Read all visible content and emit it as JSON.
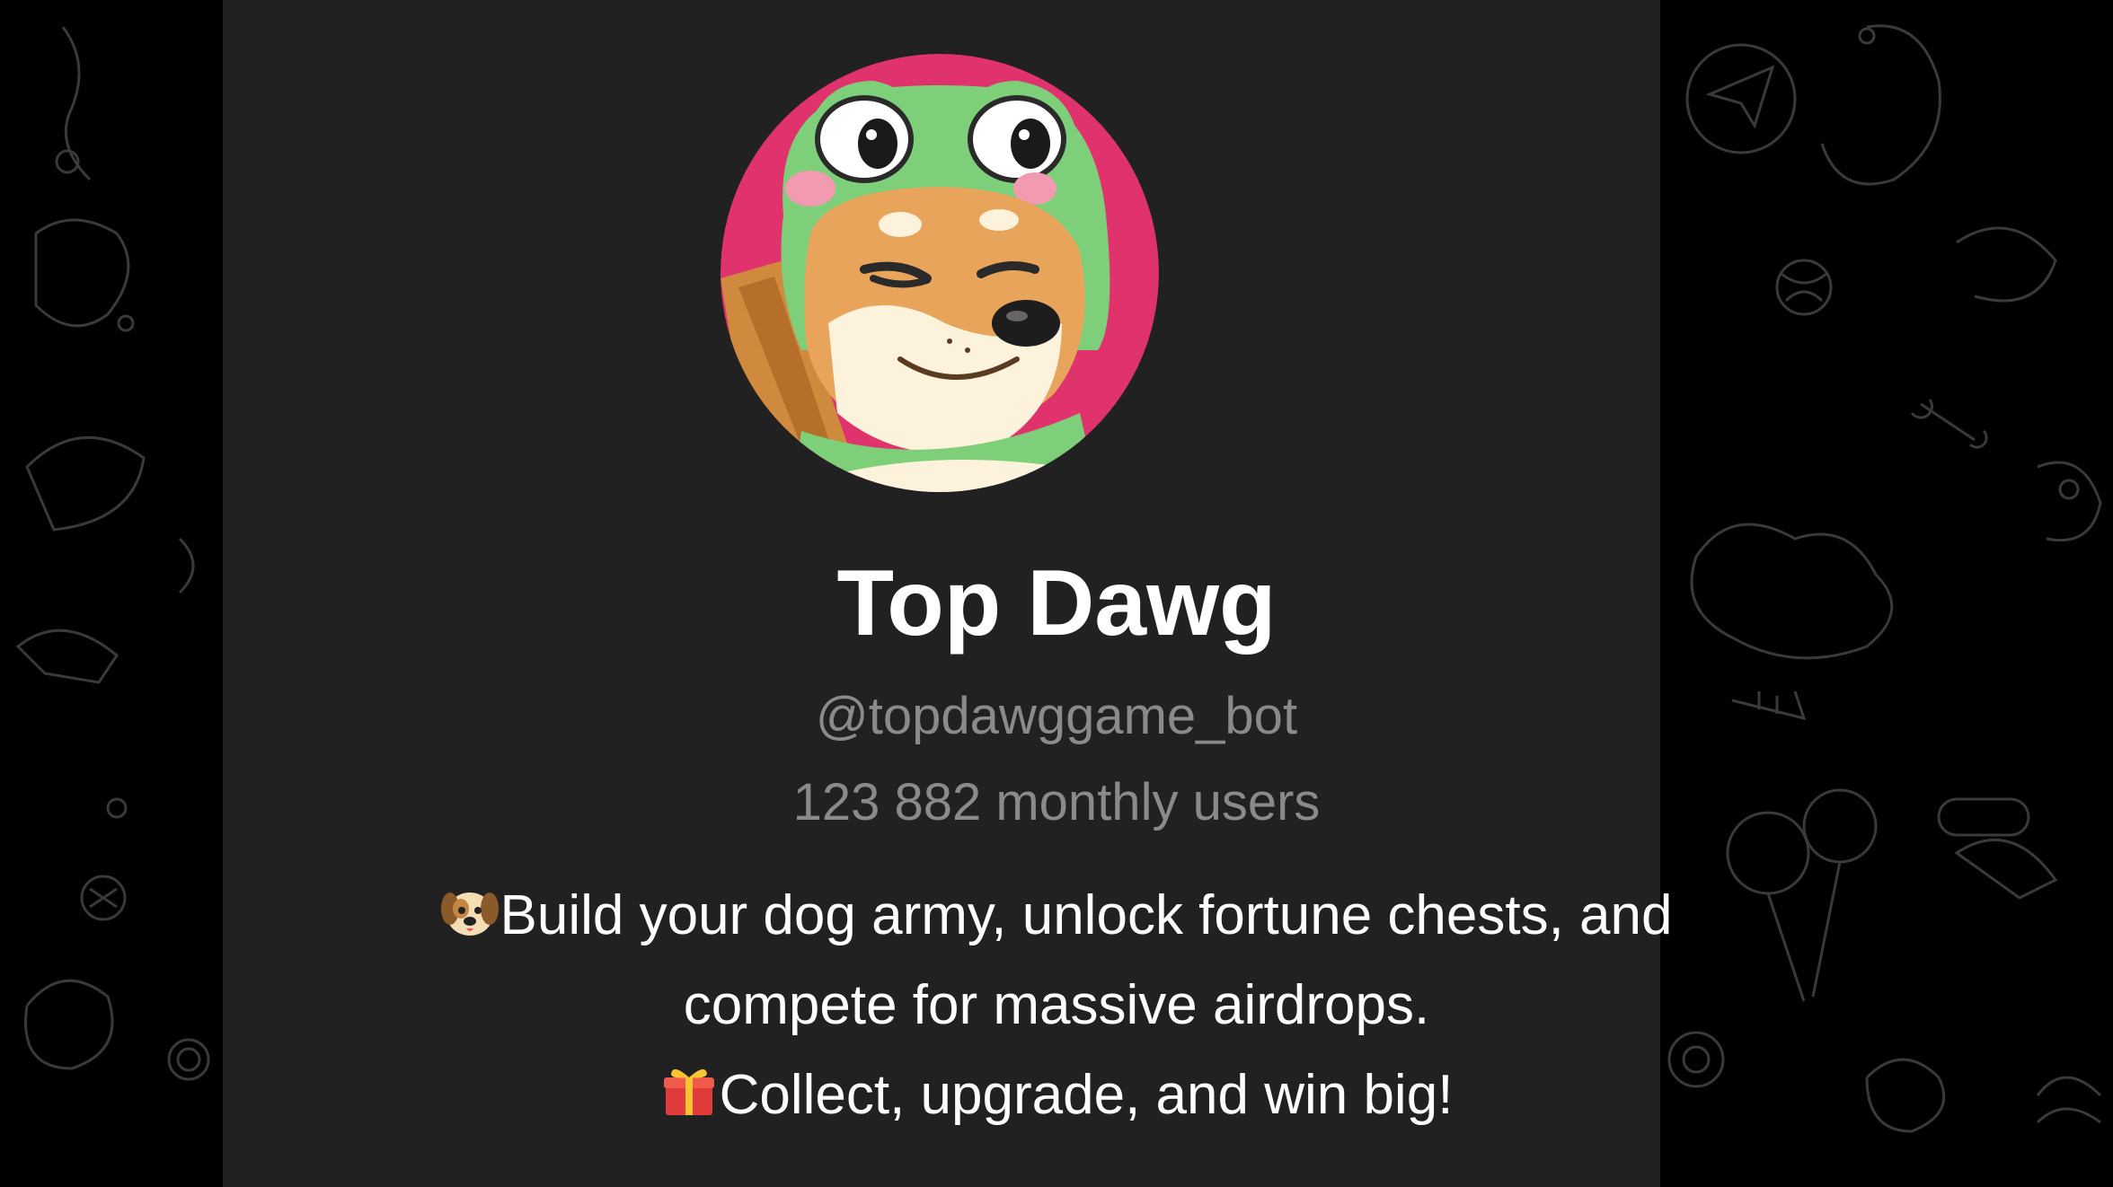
{
  "profile": {
    "name": "Top Dawg",
    "username": "@topdawggame_bot",
    "monthly_users": "123 882 monthly users",
    "description": {
      "line1": "Build your dog army, unlock fortune chests, and",
      "line2": "compete for massive airdrops.",
      "line3": "Collect, upgrade, and win big!"
    },
    "line1_emoji": "dog-face-emoji",
    "line3_emoji": "gift-emoji",
    "avatar_icon": "shiba-frog-hat-avatar"
  },
  "colors": {
    "page_bg": "#000000",
    "card_bg": "#212121",
    "title": "#ffffff",
    "secondary_text": "#8a8a8a",
    "avatar_bg": "#e0336e"
  }
}
